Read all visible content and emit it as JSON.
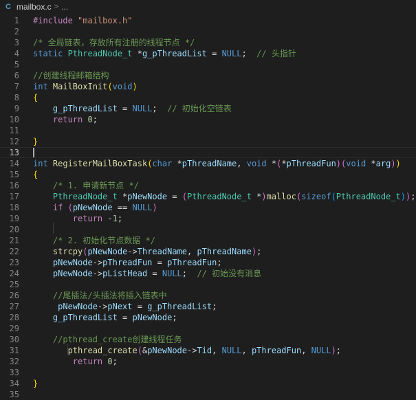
{
  "breadcrumb": {
    "file_icon": "C",
    "file": "mailbox.c",
    "separator": ">",
    "more": "..."
  },
  "colors": {
    "background": "#1e1e1e",
    "preprocessor": "#c586c0",
    "string": "#ce9178",
    "comment": "#6a9955",
    "keyword": "#569cd6",
    "type": "#4ec9b0",
    "variable": "#9cdcfe",
    "function": "#dcdcaa",
    "number": "#b5cea8"
  },
  "editor": {
    "current_line": 13,
    "lines": [
      [
        [
          "pre",
          "#include "
        ],
        [
          "str",
          "\"mailbox.h\""
        ]
      ],
      [],
      [
        [
          "com",
          "/* 全局链表，存放所有注册的线程节点 */"
        ]
      ],
      [
        [
          "kw",
          "static "
        ],
        [
          "typ",
          "PthreadNode_t"
        ],
        [
          "punc",
          " *"
        ],
        [
          "var",
          "g_pThreadList"
        ],
        [
          "punc",
          " = "
        ],
        [
          "mac",
          "NULL"
        ],
        [
          "punc",
          ";  "
        ],
        [
          "com",
          "// 头指针"
        ]
      ],
      [],
      [
        [
          "com",
          "//创建线程邮箱结构"
        ]
      ],
      [
        [
          "kw",
          "int "
        ],
        [
          "fn",
          "MailBoxInit"
        ],
        [
          "br1",
          "("
        ],
        [
          "kw",
          "void"
        ],
        [
          "br1",
          ")"
        ]
      ],
      [
        [
          "br1",
          "{"
        ]
      ],
      [
        [
          "punc",
          "    "
        ],
        [
          "var",
          "g_pThreadList"
        ],
        [
          "punc",
          " = "
        ],
        [
          "mac",
          "NULL"
        ],
        [
          "punc",
          ";  "
        ],
        [
          "com",
          "// 初始化空链表"
        ]
      ],
      [
        [
          "punc",
          "    "
        ],
        [
          "ctl",
          "return "
        ],
        [
          "num",
          "0"
        ],
        [
          "punc",
          ";"
        ]
      ],
      [],
      [
        [
          "br1",
          "}"
        ]
      ],
      [],
      [
        [
          "kw",
          "int "
        ],
        [
          "fn",
          "RegisterMailBoxTask"
        ],
        [
          "br1",
          "("
        ],
        [
          "kw",
          "char "
        ],
        [
          "punc",
          "*"
        ],
        [
          "var",
          "pThreadName"
        ],
        [
          "punc",
          ", "
        ],
        [
          "kw",
          "void "
        ],
        [
          "punc",
          "*"
        ],
        [
          "br2",
          "("
        ],
        [
          "punc",
          "*"
        ],
        [
          "var",
          "pThreadFun"
        ],
        [
          "br2",
          ")"
        ],
        [
          "br2",
          "("
        ],
        [
          "kw",
          "void "
        ],
        [
          "punc",
          "*"
        ],
        [
          "var",
          "arg"
        ],
        [
          "br2",
          ")"
        ],
        [
          "br1",
          ")"
        ]
      ],
      [
        [
          "br1",
          "{"
        ]
      ],
      [
        [
          "punc",
          "    "
        ],
        [
          "com",
          "/* 1. 申请新节点 */"
        ]
      ],
      [
        [
          "punc",
          "    "
        ],
        [
          "typ",
          "PthreadNode_t"
        ],
        [
          "punc",
          " *"
        ],
        [
          "var",
          "pNewNode"
        ],
        [
          "punc",
          " = "
        ],
        [
          "br2",
          "("
        ],
        [
          "typ",
          "PthreadNode_t"
        ],
        [
          "punc",
          " *"
        ],
        [
          "br2",
          ")"
        ],
        [
          "fn",
          "malloc"
        ],
        [
          "br2",
          "("
        ],
        [
          "kw",
          "sizeof"
        ],
        [
          "br3",
          "("
        ],
        [
          "typ",
          "PthreadNode_t"
        ],
        [
          "br3",
          ")"
        ],
        [
          "br2",
          ")"
        ],
        [
          "punc",
          ";"
        ]
      ],
      [
        [
          "punc",
          "    "
        ],
        [
          "ctl",
          "if "
        ],
        [
          "br2",
          "("
        ],
        [
          "var",
          "pNewNode"
        ],
        [
          "punc",
          " == "
        ],
        [
          "mac",
          "NULL"
        ],
        [
          "br2",
          ")"
        ]
      ],
      [
        [
          "punc",
          "        "
        ],
        [
          "ctl",
          "return "
        ],
        [
          "punc",
          "-"
        ],
        [
          "num",
          "1"
        ],
        [
          "punc",
          ";"
        ]
      ],
      [],
      [
        [
          "punc",
          "    "
        ],
        [
          "com",
          "/* 2. 初始化节点数据 */"
        ]
      ],
      [
        [
          "punc",
          "    "
        ],
        [
          "fn",
          "strcpy"
        ],
        [
          "br2",
          "("
        ],
        [
          "var",
          "pNewNode"
        ],
        [
          "punc",
          "->"
        ],
        [
          "var",
          "ThreadName"
        ],
        [
          "punc",
          ", "
        ],
        [
          "var",
          "pThreadName"
        ],
        [
          "br2",
          ")"
        ],
        [
          "punc",
          ";"
        ]
      ],
      [
        [
          "punc",
          "    "
        ],
        [
          "var",
          "pNewNode"
        ],
        [
          "punc",
          "->"
        ],
        [
          "var",
          "pThreadFun"
        ],
        [
          "punc",
          " = "
        ],
        [
          "var",
          "pThreadFun"
        ],
        [
          "punc",
          ";"
        ]
      ],
      [
        [
          "punc",
          "    "
        ],
        [
          "var",
          "pNewNode"
        ],
        [
          "punc",
          "->"
        ],
        [
          "var",
          "pListHead"
        ],
        [
          "punc",
          " = "
        ],
        [
          "mac",
          "NULL"
        ],
        [
          "punc",
          ";  "
        ],
        [
          "com",
          "// 初始没有消息"
        ]
      ],
      [],
      [
        [
          "punc",
          "    "
        ],
        [
          "com",
          "//尾插法/头插法将插入链表中"
        ]
      ],
      [
        [
          "punc",
          "     "
        ],
        [
          "var",
          "pNewNode"
        ],
        [
          "punc",
          "->"
        ],
        [
          "var",
          "pNext"
        ],
        [
          "punc",
          " = "
        ],
        [
          "var",
          "g_pThreadList"
        ],
        [
          "punc",
          ";"
        ]
      ],
      [
        [
          "punc",
          "    "
        ],
        [
          "var",
          "g_pThreadList"
        ],
        [
          "punc",
          " = "
        ],
        [
          "var",
          "pNewNode"
        ],
        [
          "punc",
          ";"
        ]
      ],
      [],
      [
        [
          "punc",
          "    "
        ],
        [
          "com",
          "//pthread_create创建线程任务"
        ]
      ],
      [
        [
          "punc",
          "       "
        ],
        [
          "fn",
          "pthread_create"
        ],
        [
          "br2",
          "("
        ],
        [
          "punc",
          "&"
        ],
        [
          "var",
          "pNewNode"
        ],
        [
          "punc",
          "->"
        ],
        [
          "var",
          "Tid"
        ],
        [
          "punc",
          ", "
        ],
        [
          "mac",
          "NULL"
        ],
        [
          "punc",
          ", "
        ],
        [
          "var",
          "pThreadFun"
        ],
        [
          "punc",
          ", "
        ],
        [
          "mac",
          "NULL"
        ],
        [
          "br2",
          ")"
        ],
        [
          "punc",
          ";"
        ]
      ],
      [
        [
          "punc",
          "        "
        ],
        [
          "ctl",
          "return "
        ],
        [
          "num",
          "0"
        ],
        [
          "punc",
          ";"
        ]
      ],
      [],
      [
        [
          "br1",
          "}"
        ]
      ],
      []
    ]
  }
}
